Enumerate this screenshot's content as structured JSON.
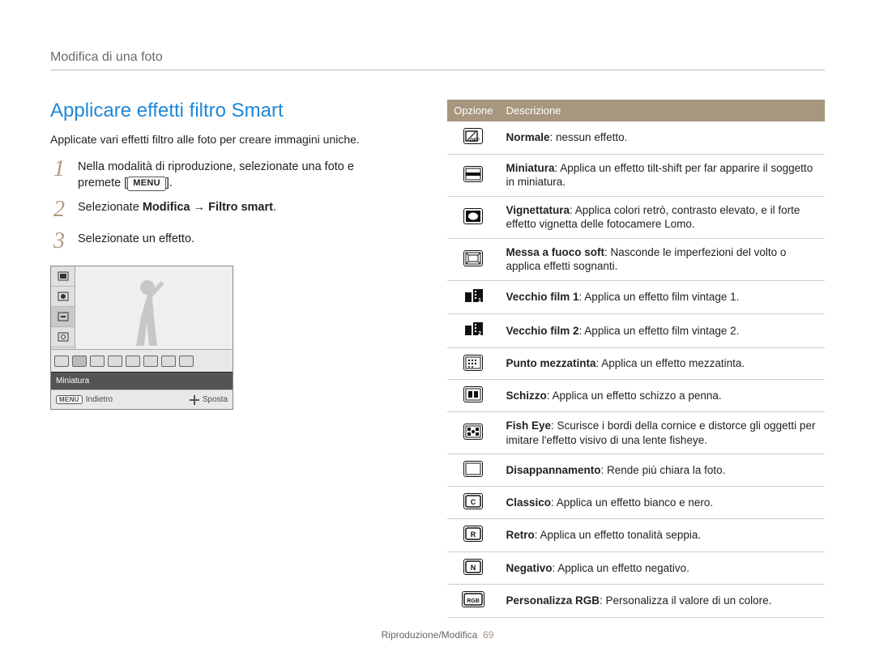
{
  "header": "Modifica di una foto",
  "section_title": "Applicare effetti filtro Smart",
  "intro": "Applicate vari effetti filtro alle foto per creare immagini uniche.",
  "steps": [
    {
      "num": "1",
      "pre": "Nella modalità di riproduzione, selezionate una foto e premete [",
      "chip": "MENU",
      "post": "]."
    },
    {
      "num": "2",
      "pre": "Selezionate ",
      "bold": "Modifica → Filtro smart",
      "post": "."
    },
    {
      "num": "3",
      "pre": "Selezionate un effetto."
    }
  ],
  "screenshot": {
    "label": "Miniatura",
    "footer_left_chip": "MENU",
    "footer_left": "Indietro",
    "footer_right": "Sposta"
  },
  "table": {
    "head_left": "Opzione",
    "head_right": "Descrizione",
    "rows": [
      {
        "icon": "off",
        "name": "Normale",
        "desc": ": nessun effetto."
      },
      {
        "icon": "mini",
        "name": "Miniatura",
        "desc": ": Applica un effetto tilt-shift per far apparire il soggetto in miniatura."
      },
      {
        "icon": "vign",
        "name": "Vignettatura",
        "desc": ": Applica colori retrò, contrasto elevato, e il forte effetto vignetta delle fotocamere Lomo."
      },
      {
        "icon": "soft",
        "name": "Messa a fuoco soft",
        "desc": ": Nasconde le imperfezioni del volto o applica effetti sognanti."
      },
      {
        "icon": "film1",
        "name": "Vecchio film 1",
        "desc": ": Applica un effetto film vintage 1."
      },
      {
        "icon": "film2",
        "name": "Vecchio film 2",
        "desc": ": Applica un effetto film vintage 2."
      },
      {
        "icon": "half",
        "name": "Punto mezzatinta",
        "desc": ": Applica un effetto mezzatinta."
      },
      {
        "icon": "sketch",
        "name": "Schizzo",
        "desc": ": Applica un effetto schizzo a penna."
      },
      {
        "icon": "fish",
        "name": "Fish Eye",
        "desc": ": Scurisce i bordi della cornice e distorce gli oggetti per imitare l'effetto visivo di una lente fisheye."
      },
      {
        "icon": "defog",
        "name": "Disappannamento",
        "desc": ": Rende più chiara la foto."
      },
      {
        "icon": "class",
        "name": "Classico",
        "desc": ": Applica un effetto bianco e nero."
      },
      {
        "icon": "retro",
        "name": "Retro",
        "desc": ": Applica un effetto tonalità seppia."
      },
      {
        "icon": "neg",
        "name": "Negativo",
        "desc": ": Applica un effetto negativo."
      },
      {
        "icon": "rgb",
        "name": "Personalizza RGB",
        "desc": ": Personalizza il valore di un colore."
      }
    ]
  },
  "footer": {
    "section": "Riproduzione/Modifica",
    "page": "69"
  }
}
